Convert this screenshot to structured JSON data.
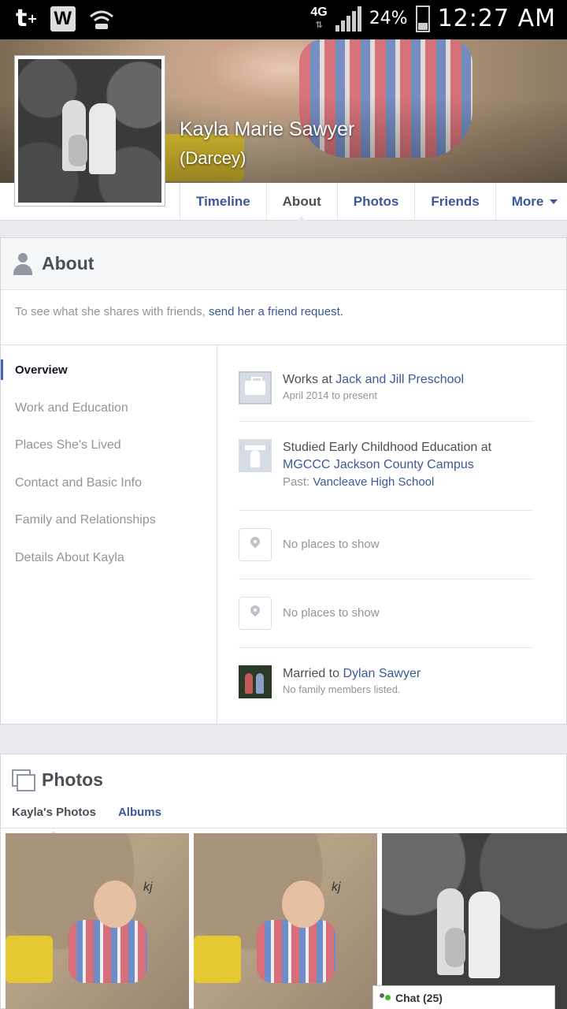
{
  "status_bar": {
    "left_icons": [
      "tumblr-icon",
      "widget-w-icon",
      "wifi-icon"
    ],
    "tumblr": "t",
    "widget": "W",
    "network": "4G",
    "battery_percent": "24%",
    "time": "12:27 AM"
  },
  "profile": {
    "name": "Kayla Marie Sawyer",
    "nickname": "(Darcey)"
  },
  "tabs": [
    {
      "label": "Timeline",
      "active": false
    },
    {
      "label": "About",
      "active": true
    },
    {
      "label": "Photos",
      "active": false
    },
    {
      "label": "Friends",
      "active": false
    },
    {
      "label": "More",
      "active": false
    }
  ],
  "about": {
    "title": "About",
    "note_prefix": "To see what she shares with friends, ",
    "note_link": "send her a friend request.",
    "side_nav": [
      "Overview",
      "Work and Education",
      "Places She's Lived",
      "Contact and Basic Info",
      "Family and Relationships",
      "Details About Kayla"
    ],
    "overview": {
      "work": {
        "prefix": "Works at ",
        "employer": "Jack and Jill Preschool",
        "dates": "April 2014 to present"
      },
      "education": {
        "prefix": "Studied Early Childhood Education at",
        "school": "MGCCC Jackson County Campus",
        "past_label": "Past: ",
        "past_school": "Vancleave High School"
      },
      "place1": "No places to show",
      "place2": "No places to show",
      "relationship": {
        "prefix": "Married to ",
        "partner": "Dylan Sawyer",
        "family_note": "No family members listed."
      }
    }
  },
  "photos": {
    "title": "Photos",
    "tabs": [
      "Kayla's Photos",
      "Albums"
    ],
    "watermark": "kj"
  },
  "chat": {
    "label": "Chat (25)"
  }
}
